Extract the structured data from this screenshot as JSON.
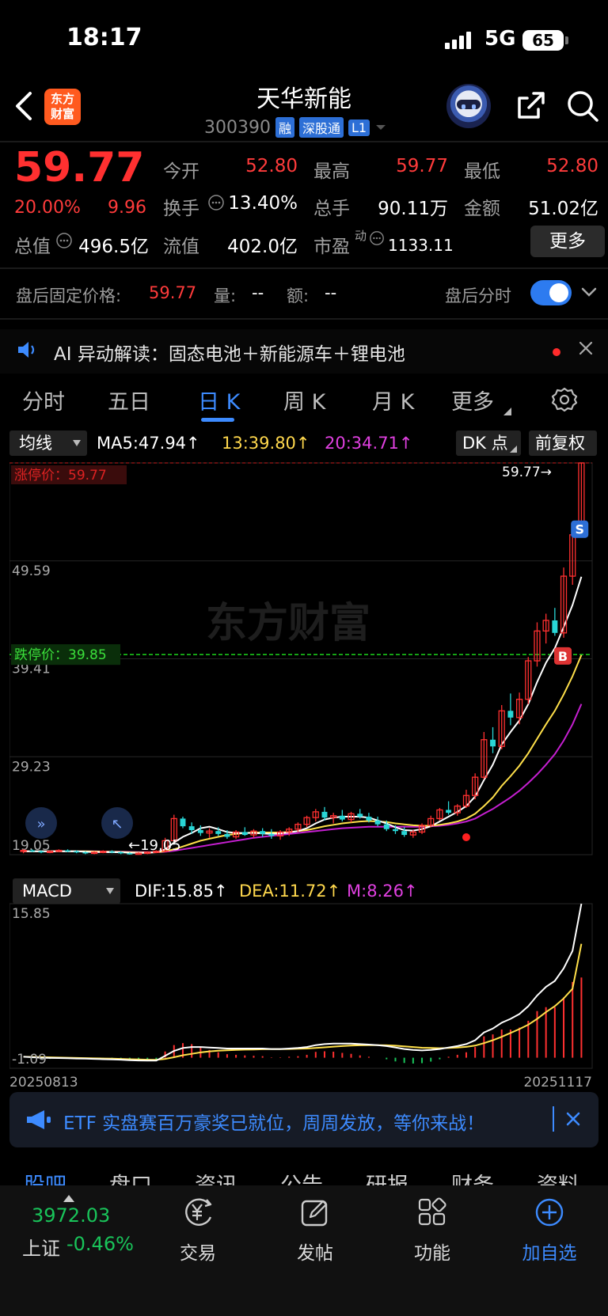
{
  "status": {
    "time": "18:17",
    "network": "5G",
    "battery": "65"
  },
  "header": {
    "logo_line1": "东方",
    "logo_line2": "财富",
    "name": "天华新能",
    "code": "300390",
    "tags": [
      "融",
      "深股通",
      "L1"
    ]
  },
  "quote": {
    "price": "59.77",
    "pct": "20.00%",
    "change": "9.96",
    "open_label": "今开",
    "open": "52.80",
    "high_label": "最高",
    "high": "59.77",
    "low_label": "最低",
    "low": "52.80",
    "turnover_label": "换手",
    "turnover": "13.40%",
    "volume_label": "总手",
    "volume": "90.11万",
    "amount_label": "金额",
    "amount": "51.02亿",
    "mcap_label": "总值",
    "mcap": "496.5亿",
    "float_label": "流值",
    "float": "402.0亿",
    "pe_label": "市盈",
    "pe_sup": "动",
    "pe": "1133.11",
    "more": "更多"
  },
  "after_hours": {
    "label": "盘后固定价格:",
    "price": "59.77",
    "vol_label": "量:",
    "vol": "--",
    "amt_label": "额:",
    "amt": "--",
    "toggle_label": "盘后分时"
  },
  "ai": {
    "text": "AI 异动解读：固态电池＋新能源车＋锂电池"
  },
  "period_tabs": [
    "分时",
    "五日",
    "日 K",
    "周 K",
    "月 K",
    "更多"
  ],
  "indicators": {
    "ma_select": "均线",
    "ma5": "MA5:47.94",
    "ma13": "13:39.80",
    "ma20": "20:34.71",
    "dk": "DK 点",
    "adjust": "前复权"
  },
  "chart_data": [
    {
      "type": "candlestick",
      "title": "",
      "y_ticks": [
        "59.77",
        "49.59",
        "39.41",
        "29.23",
        "19.05"
      ],
      "ylim": [
        19.05,
        59.77
      ],
      "limit_up_label": "涨停价：59.77",
      "limit_down_label": "跌停价：39.85",
      "limit_down": 39.85,
      "last_label": "59.77",
      "min_label": "19.05",
      "watermark": "东方财富",
      "candles": [
        [
          19.4,
          19.6,
          19.2,
          19.5
        ],
        [
          19.5,
          19.6,
          19.3,
          19.4
        ],
        [
          19.4,
          19.5,
          19.2,
          19.3
        ],
        [
          19.3,
          19.5,
          19.2,
          19.4
        ],
        [
          19.4,
          19.6,
          19.3,
          19.5
        ],
        [
          19.5,
          19.6,
          19.3,
          19.4
        ],
        [
          19.4,
          19.5,
          19.2,
          19.3
        ],
        [
          19.3,
          19.4,
          19.1,
          19.2
        ],
        [
          19.2,
          19.4,
          19.1,
          19.3
        ],
        [
          19.3,
          19.5,
          19.2,
          19.4
        ],
        [
          19.4,
          19.5,
          19.2,
          19.3
        ],
        [
          19.3,
          19.4,
          19.1,
          19.2
        ],
        [
          19.2,
          19.3,
          19.05,
          19.1
        ],
        [
          19.1,
          19.3,
          19.05,
          19.2
        ],
        [
          19.2,
          19.4,
          19.1,
          19.3
        ],
        [
          19.3,
          19.5,
          19.2,
          19.4
        ],
        [
          19.4,
          20.8,
          19.3,
          20.5
        ],
        [
          20.5,
          23.2,
          20.3,
          22.8
        ],
        [
          22.8,
          23.0,
          21.8,
          22.0
        ],
        [
          22.0,
          22.4,
          21.2,
          21.6
        ],
        [
          21.6,
          22.1,
          21.0,
          21.3
        ],
        [
          21.3,
          21.8,
          20.8,
          21.5
        ],
        [
          21.5,
          21.9,
          21.0,
          21.2
        ],
        [
          21.2,
          21.6,
          20.7,
          20.9
        ],
        [
          20.9,
          21.6,
          20.7,
          21.4
        ],
        [
          21.4,
          21.9,
          21.0,
          21.1
        ],
        [
          21.1,
          21.7,
          20.8,
          21.5
        ],
        [
          21.5,
          21.8,
          20.9,
          21.2
        ],
        [
          21.2,
          21.7,
          20.7,
          21.0
        ],
        [
          21.0,
          21.6,
          20.6,
          21.4
        ],
        [
          21.4,
          21.9,
          21.0,
          21.7
        ],
        [
          21.7,
          22.4,
          21.4,
          22.2
        ],
        [
          22.2,
          23.1,
          21.9,
          22.9
        ],
        [
          22.9,
          23.8,
          22.5,
          23.5
        ],
        [
          23.5,
          24.0,
          22.6,
          22.9
        ],
        [
          22.9,
          23.4,
          22.3,
          23.1
        ],
        [
          23.1,
          23.7,
          22.5,
          22.7
        ],
        [
          22.7,
          23.5,
          22.4,
          23.3
        ],
        [
          23.3,
          23.8,
          22.8,
          23.0
        ],
        [
          23.0,
          23.4,
          22.4,
          22.6
        ],
        [
          22.6,
          23.0,
          22.0,
          22.2
        ],
        [
          22.2,
          22.6,
          21.5,
          21.7
        ],
        [
          21.7,
          22.1,
          21.2,
          21.5
        ],
        [
          21.5,
          21.9,
          20.9,
          21.1
        ],
        [
          21.1,
          21.6,
          20.8,
          21.4
        ],
        [
          21.4,
          22.3,
          21.2,
          22.1
        ],
        [
          22.1,
          23.1,
          21.9,
          22.8
        ],
        [
          22.8,
          23.9,
          22.6,
          23.7
        ],
        [
          23.7,
          24.6,
          23.2,
          23.4
        ],
        [
          23.4,
          24.3,
          23.1,
          24.1
        ],
        [
          24.1,
          25.8,
          23.9,
          25.2
        ],
        [
          25.2,
          27.5,
          24.8,
          27.1
        ],
        [
          27.1,
          31.8,
          26.9,
          31.0
        ],
        [
          31.0,
          32.3,
          29.6,
          30.3
        ],
        [
          30.3,
          34.6,
          30.0,
          34.0
        ],
        [
          34.0,
          35.8,
          32.5,
          33.3
        ],
        [
          33.3,
          35.9,
          32.6,
          35.2
        ],
        [
          35.2,
          39.6,
          34.7,
          39.2
        ],
        [
          39.2,
          43.2,
          38.6,
          42.3
        ],
        [
          42.3,
          44.1,
          41.0,
          43.4
        ],
        [
          43.4,
          44.7,
          41.8,
          42.1
        ],
        [
          42.1,
          48.9,
          41.6,
          48.0
        ],
        [
          48.0,
          52.8,
          47.1,
          52.3
        ],
        [
          52.8,
          59.77,
          52.8,
          59.77
        ]
      ],
      "ma5": [
        19.4,
        19.4,
        19.4,
        19.4,
        19.4,
        19.4,
        19.4,
        19.35,
        19.32,
        19.32,
        19.3,
        19.3,
        19.25,
        19.23,
        19.25,
        19.3,
        19.6,
        20.3,
        20.9,
        21.3,
        21.8,
        21.95,
        21.7,
        21.4,
        21.3,
        21.3,
        21.3,
        21.25,
        21.2,
        21.25,
        21.35,
        21.5,
        21.8,
        22.3,
        22.7,
        22.9,
        23.0,
        23.0,
        23.0,
        22.9,
        22.6,
        22.3,
        21.9,
        21.6,
        21.55,
        21.7,
        22.0,
        22.5,
        23.0,
        23.5,
        24.1,
        25.1,
        26.8,
        28.4,
        30.5,
        31.8,
        33.0,
        34.7,
        37.0,
        39.0,
        40.5,
        42.7,
        45.0,
        47.94
      ],
      "ma13": [
        19.4,
        19.4,
        19.4,
        19.4,
        19.4,
        19.4,
        19.4,
        19.4,
        19.38,
        19.36,
        19.35,
        19.33,
        19.3,
        19.28,
        19.28,
        19.3,
        19.4,
        19.6,
        19.9,
        20.2,
        20.5,
        20.7,
        20.9,
        21.1,
        21.2,
        21.3,
        21.35,
        21.35,
        21.35,
        21.35,
        21.4,
        21.5,
        21.6,
        21.8,
        22.0,
        22.15,
        22.3,
        22.4,
        22.5,
        22.55,
        22.5,
        22.45,
        22.3,
        22.2,
        22.1,
        22.05,
        22.05,
        22.15,
        22.3,
        22.5,
        22.8,
        23.3,
        24.1,
        25.0,
        26.2,
        27.2,
        28.3,
        29.6,
        31.1,
        32.6,
        34.0,
        35.7,
        37.6,
        39.8
      ],
      "ma20": [
        19.4,
        19.4,
        19.4,
        19.4,
        19.4,
        19.4,
        19.4,
        19.4,
        19.4,
        19.38,
        19.37,
        19.36,
        19.34,
        19.32,
        19.31,
        19.3,
        19.35,
        19.45,
        19.6,
        19.75,
        19.9,
        20.05,
        20.2,
        20.35,
        20.5,
        20.65,
        20.8,
        20.9,
        21.0,
        21.1,
        21.2,
        21.3,
        21.4,
        21.5,
        21.6,
        21.7,
        21.8,
        21.85,
        21.9,
        21.95,
        21.95,
        21.95,
        21.95,
        21.95,
        21.95,
        21.95,
        22.0,
        22.05,
        22.15,
        22.3,
        22.5,
        22.8,
        23.3,
        23.8,
        24.4,
        25.0,
        25.7,
        26.5,
        27.4,
        28.4,
        29.5,
        30.9,
        32.6,
        34.71
      ],
      "markers": [
        {
          "label": "S",
          "index": 62
        },
        {
          "label": "B",
          "index": 61
        }
      ]
    },
    {
      "type": "macd",
      "select_label": "MACD",
      "dif_label": "DIF:15.85",
      "dea_label": "DEA:11.72",
      "m_label": "M:8.26",
      "y_ticks": [
        "15.85",
        "-1.09"
      ],
      "ylim": [
        -1.09,
        15.85
      ],
      "x_ticks": [
        "20250813",
        "20251117"
      ],
      "dif": [
        0.1,
        0.05,
        0.0,
        -0.02,
        -0.03,
        -0.05,
        -0.08,
        -0.1,
        -0.12,
        -0.15,
        -0.18,
        -0.2,
        -0.25,
        -0.28,
        -0.3,
        -0.3,
        0.2,
        0.7,
        1.0,
        1.1,
        1.1,
        1.05,
        1.0,
        0.95,
        0.95,
        0.95,
        0.95,
        0.95,
        0.9,
        0.9,
        0.95,
        1.0,
        1.1,
        1.3,
        1.4,
        1.45,
        1.45,
        1.45,
        1.4,
        1.35,
        1.3,
        1.2,
        1.05,
        0.9,
        0.8,
        0.75,
        0.8,
        0.9,
        1.05,
        1.2,
        1.4,
        1.8,
        2.6,
        3.0,
        3.6,
        4.0,
        4.5,
        5.3,
        6.4,
        7.3,
        7.9,
        9.2,
        11.0,
        15.85
      ],
      "dea": [
        0.1,
        0.08,
        0.06,
        0.04,
        0.02,
        0.0,
        -0.02,
        -0.04,
        -0.06,
        -0.08,
        -0.1,
        -0.12,
        -0.15,
        -0.18,
        -0.2,
        -0.22,
        -0.12,
        0.05,
        0.25,
        0.4,
        0.55,
        0.65,
        0.72,
        0.77,
        0.8,
        0.83,
        0.85,
        0.87,
        0.88,
        0.88,
        0.9,
        0.92,
        0.95,
        1.0,
        1.07,
        1.14,
        1.2,
        1.25,
        1.28,
        1.3,
        1.3,
        1.28,
        1.24,
        1.17,
        1.1,
        1.03,
        1.0,
        0.98,
        1.0,
        1.05,
        1.12,
        1.25,
        1.5,
        1.8,
        2.15,
        2.55,
        2.95,
        3.4,
        4.0,
        4.7,
        5.3,
        6.1,
        7.1,
        11.72
      ],
      "hist": [
        0.0,
        -0.05,
        -0.1,
        -0.12,
        -0.1,
        -0.1,
        -0.12,
        -0.12,
        -0.12,
        -0.14,
        -0.16,
        -0.16,
        -0.2,
        -0.2,
        -0.2,
        -0.16,
        0.64,
        1.3,
        1.5,
        1.4,
        1.1,
        0.8,
        0.56,
        0.36,
        0.3,
        0.24,
        0.2,
        0.16,
        0.04,
        0.04,
        0.1,
        0.16,
        0.3,
        0.6,
        0.66,
        0.62,
        0.5,
        0.4,
        0.24,
        0.1,
        0.0,
        -0.16,
        -0.38,
        -0.54,
        -0.6,
        -0.56,
        -0.4,
        -0.16,
        0.1,
        0.3,
        0.56,
        1.1,
        2.2,
        2.4,
        2.9,
        2.9,
        3.1,
        3.8,
        4.8,
        5.2,
        5.2,
        6.2,
        7.8,
        8.26
      ]
    }
  ],
  "promo": {
    "text": "ETF 实盘赛百万豪奖已就位，周周发放，等你来战！"
  },
  "bottom_tabs": [
    "股吧",
    "盘口",
    "资讯",
    "公告",
    "研报",
    "财务",
    "资料"
  ],
  "bottom_nav": {
    "index_value": "3972.03",
    "index_name": "上证",
    "index_pct": "-0.46%",
    "items": [
      "交易",
      "发帖",
      "功能",
      "加自选"
    ]
  }
}
